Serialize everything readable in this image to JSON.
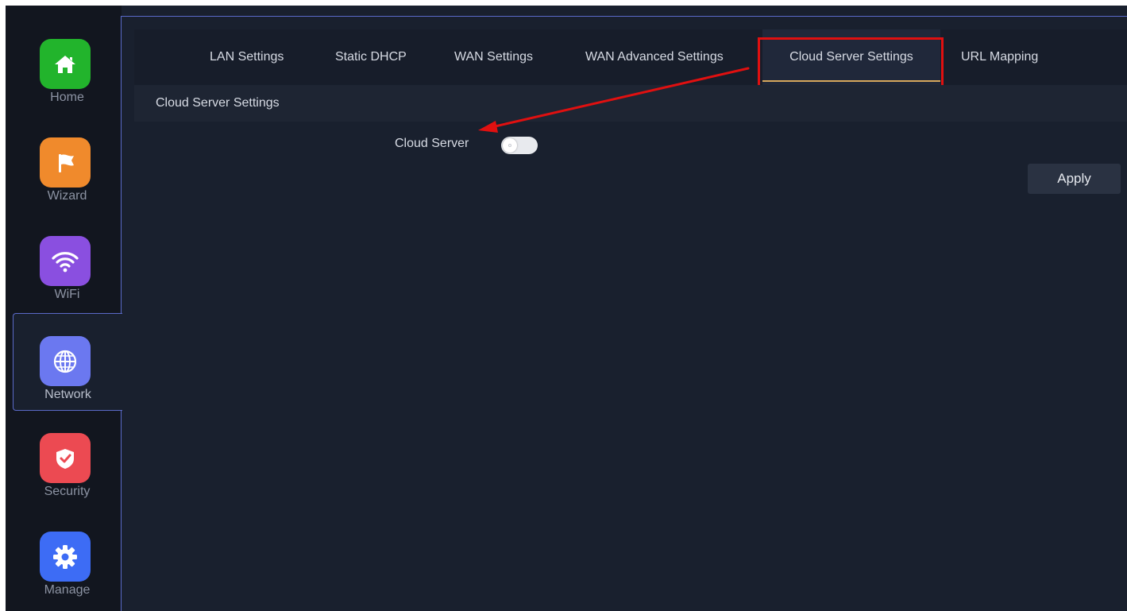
{
  "sidebar": {
    "items": [
      {
        "label": "Home",
        "icon": "home-icon",
        "color": "#22b42c",
        "active": false
      },
      {
        "label": "Wizard",
        "icon": "flag-icon",
        "color": "#f08a2c",
        "active": false
      },
      {
        "label": "WiFi",
        "icon": "wifi-icon",
        "color": "#8a4fe0",
        "active": false
      },
      {
        "label": "Network",
        "icon": "globe-icon",
        "color": "#6b78f0",
        "active": true
      },
      {
        "label": "Security",
        "icon": "shield-icon",
        "color": "#ec4a52",
        "active": false
      },
      {
        "label": "Manage",
        "icon": "gear-icon",
        "color": "#3d6cf5",
        "active": false
      }
    ]
  },
  "tabs": [
    {
      "label": "LAN Settings",
      "active": false
    },
    {
      "label": "Static DHCP",
      "active": false
    },
    {
      "label": "WAN Settings",
      "active": false
    },
    {
      "label": "WAN Advanced Settings",
      "active": false
    },
    {
      "label": "Cloud Server Settings",
      "active": true
    },
    {
      "label": "URL Mapping",
      "active": false
    }
  ],
  "section": {
    "title": "Cloud Server Settings"
  },
  "form": {
    "cloud_server_label": "Cloud Server",
    "cloud_server_enabled": false
  },
  "actions": {
    "apply_label": "Apply"
  },
  "colors": {
    "accent": "#d6a75c",
    "annotation": "#e01010",
    "active_border": "#5a6ac8"
  }
}
